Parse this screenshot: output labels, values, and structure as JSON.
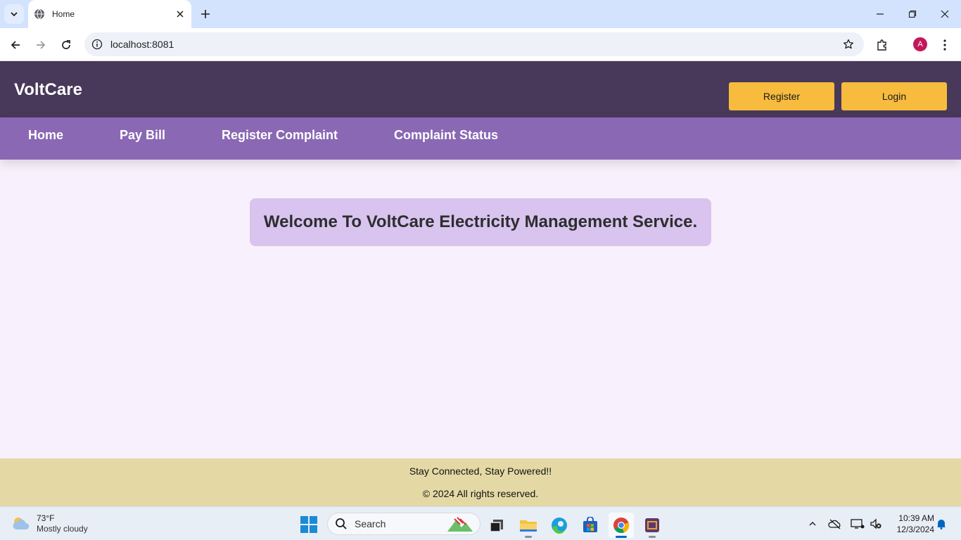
{
  "browser": {
    "tab_title": "Home",
    "url": "localhost:8081",
    "profile_initial": "A"
  },
  "site": {
    "logo": "VoltCare",
    "header_buttons": {
      "register": "Register",
      "login": "Login"
    },
    "nav": [
      "Home",
      "Pay Bill",
      "Register Complaint",
      "Complaint Status"
    ],
    "welcome": "Welcome To VoltCare Electricity Management Service.",
    "footer": {
      "tagline": "Stay Connected, Stay Powered!!",
      "copyright": "© 2024 All rights reserved."
    }
  },
  "taskbar": {
    "weather": {
      "temp": "73°F",
      "condition": "Mostly cloudy"
    },
    "search_placeholder": "Search",
    "time": "10:39 AM",
    "date": "12/3/2024"
  },
  "colors": {
    "header_bg": "#483859",
    "nav_bg": "#8a68b4",
    "button_bg": "#f7bb3e",
    "welcome_bg": "#d8c4ee",
    "page_bg": "#f8f0fc",
    "footer_bg": "#e4d9a5"
  }
}
